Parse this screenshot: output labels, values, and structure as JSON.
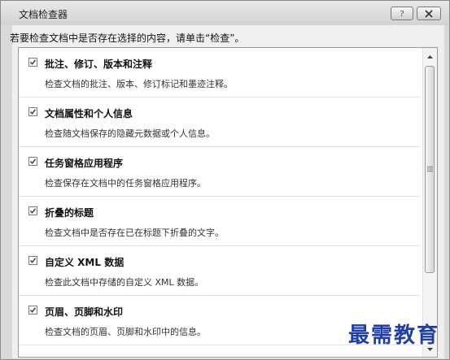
{
  "window": {
    "title": "文档检查器",
    "help_label": "?"
  },
  "instruction": "若要检查文档中是否存在选择的内容，请单击“检查”。",
  "items": [
    {
      "title": "批注、修订、版本和注释",
      "description": "检查文档的批注、版本、修订标记和墨迹注释。",
      "checked": true
    },
    {
      "title": "文档属性和个人信息",
      "description": "检查随文档保存的隐藏元数据或个人信息。",
      "checked": true
    },
    {
      "title": "任务窗格应用程序",
      "description": "检查保存在文档中的任务窗格应用程序。",
      "checked": true
    },
    {
      "title": "折叠的标题",
      "description": "检查文档中是否存在已在标题下折叠的文字。",
      "checked": true
    },
    {
      "title": "自定义 XML 数据",
      "description": "检查此文档中存储的自定义 XML 数据。",
      "checked": true
    },
    {
      "title": "页眉、页脚和水印",
      "description": "检查文档的页眉、页脚和水印中的信息。",
      "checked": true
    }
  ],
  "watermark": "最需教育",
  "colors": {
    "watermark": "#1f3fa8"
  }
}
